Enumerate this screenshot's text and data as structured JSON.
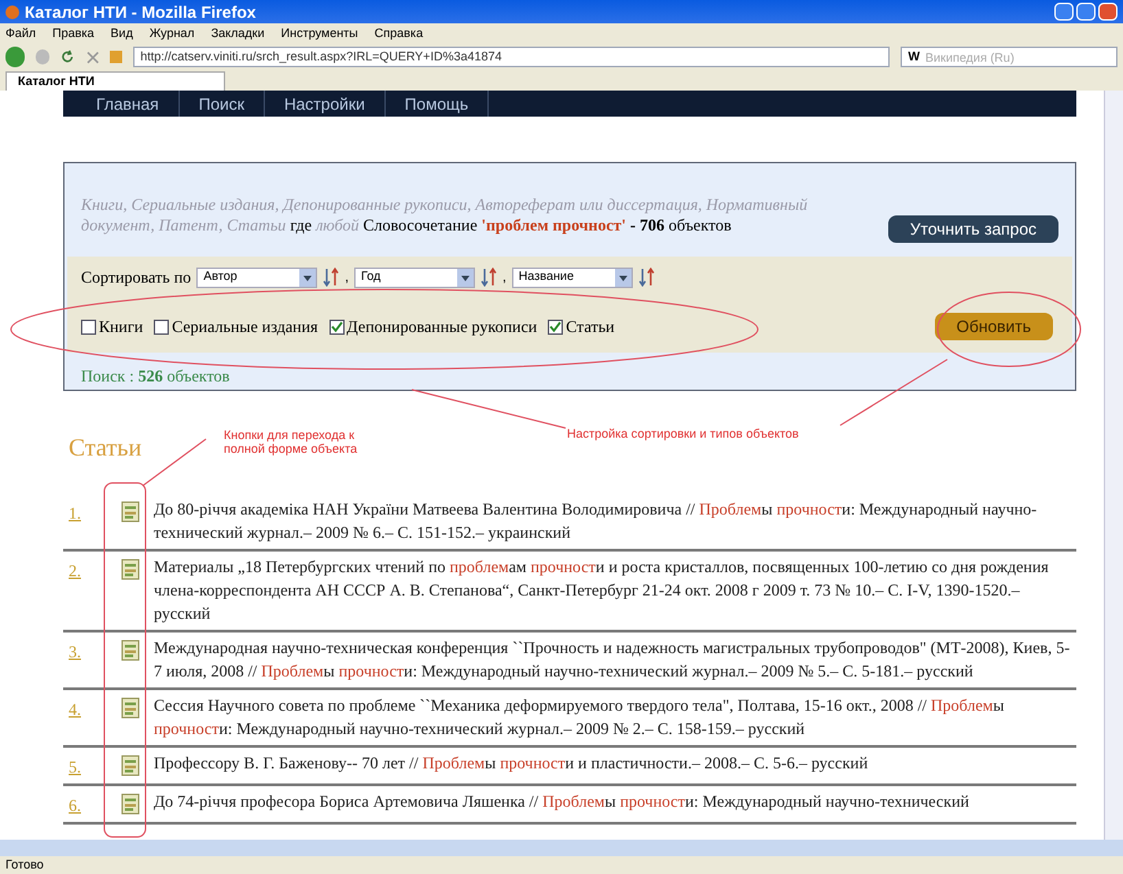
{
  "window": {
    "title": "Каталог НТИ - Mozilla Firefox"
  },
  "menu": [
    "Файл",
    "Правка",
    "Вид",
    "Журнал",
    "Закладки",
    "Инструменты",
    "Справка"
  ],
  "address": "http://catserv.viniti.ru/srch_result.aspx?IRL=QUERY+ID%3a41874",
  "search": {
    "placeholder": "Википедия (Ru)",
    "engine": "W"
  },
  "tab": {
    "label": "Каталог НТИ"
  },
  "nav": [
    "Главная",
    "Поиск",
    "Настройки",
    "Помощь"
  ],
  "query": [
    {
      "kind": "muted",
      "text": "Книги, Сериальные издания, Депонированные рукописи, Автореферат или диссертация, Нормативный документ, Патент, Статьи"
    },
    {
      "kind": "plain",
      "text": " где "
    },
    {
      "kind": "muted",
      "text": "любой"
    },
    {
      "kind": "plain",
      "text": " Словосочетание "
    },
    {
      "kind": "term",
      "text": "'проблем прочност'"
    },
    {
      "kind": "count",
      "text": " - 706"
    },
    {
      "kind": "plain",
      "text": " объектов"
    }
  ],
  "refine_button": "Уточнить запрос",
  "sort": {
    "label": "Сортировать по",
    "separator": ",",
    "fields": [
      "Автор",
      "Год",
      "Название"
    ]
  },
  "types": [
    {
      "label": "Книги",
      "checked": false
    },
    {
      "label": "Сериальные издания",
      "checked": false
    },
    {
      "label": "Депонированные рукописи",
      "checked": true
    },
    {
      "label": "Статьи",
      "checked": true
    }
  ],
  "update_button": "Обновить",
  "found": {
    "label": "Поиск :",
    "count": "526",
    "unit": "объектов"
  },
  "section_title": "Статьи",
  "results": [
    {
      "number": "1.",
      "segments": [
        {
          "text": "До 80-річчя академіка НАН України Матвеева Валентина Володимировича // ",
          "highlight": false
        },
        {
          "text": "Проблем",
          "highlight": true
        },
        {
          "text": "ы ",
          "highlight": false
        },
        {
          "text": "прочност",
          "highlight": true
        },
        {
          "text": "и: Международный научно-технический журнал.– 2009 № 6.– С. 151-152.– украинский",
          "highlight": false
        }
      ]
    },
    {
      "number": "2.",
      "segments": [
        {
          "text": "Материалы „18 Петербургских чтений по ",
          "highlight": false
        },
        {
          "text": "проблем",
          "highlight": true
        },
        {
          "text": "ам ",
          "highlight": false
        },
        {
          "text": "прочност",
          "highlight": true
        },
        {
          "text": "и и роста кристаллов, посвященных 100-летию со дня рождения члена-корреспондента АН СССР А. В. Степанова“, Санкт-Петербург 21-24 окт. 2008 г 2009 т. 73 № 10.– С. I-V, 1390-1520.– русский",
          "highlight": false
        }
      ]
    },
    {
      "number": "3.",
      "segments": [
        {
          "text": "Международная научно-техническая конференция ``Прочность и надежность магистральных трубопроводов\" (МТ-2008), Киев, 5-7 июля, 2008 // ",
          "highlight": false
        },
        {
          "text": "Проблем",
          "highlight": true
        },
        {
          "text": "ы ",
          "highlight": false
        },
        {
          "text": "прочност",
          "highlight": true
        },
        {
          "text": "и: Международный научно-технический журнал.– 2009 № 5.– С. 5-181.– русский",
          "highlight": false
        }
      ]
    },
    {
      "number": "4.",
      "segments": [
        {
          "text": "Сессия Научного совета по проблеме ``Механика деформируемого твердого тела\", Полтава, 15-16 окт., 2008 // ",
          "highlight": false
        },
        {
          "text": "Проблем",
          "highlight": true
        },
        {
          "text": "ы ",
          "highlight": false
        },
        {
          "text": "прочност",
          "highlight": true
        },
        {
          "text": "и: Международный научно-технический журнал.– 2009 № 2.– С. 158-159.– русский",
          "highlight": false
        }
      ]
    },
    {
      "number": "5.",
      "segments": [
        {
          "text": "Профессору В. Г. Баженову-- 70 лет // ",
          "highlight": false
        },
        {
          "text": "Проблем",
          "highlight": true
        },
        {
          "text": "ы ",
          "highlight": false
        },
        {
          "text": "прочност",
          "highlight": true
        },
        {
          "text": "и и пластичности.– 2008.– С. 5-6.– русский",
          "highlight": false
        }
      ]
    },
    {
      "number": "6.",
      "segments": [
        {
          "text": "До 74-річчя професора Бориса Артемовича Ляшенка // ",
          "highlight": false
        },
        {
          "text": "Проблем",
          "highlight": true
        },
        {
          "text": "ы ",
          "highlight": false
        },
        {
          "text": "прочност",
          "highlight": true
        },
        {
          "text": "и: Международный научно-технический",
          "highlight": false
        }
      ]
    }
  ],
  "annotations": [
    "Кнопки для перехода к полной форме объекта",
    "Настройка сортировки и типов объектов"
  ],
  "status_bar": "Готово"
}
